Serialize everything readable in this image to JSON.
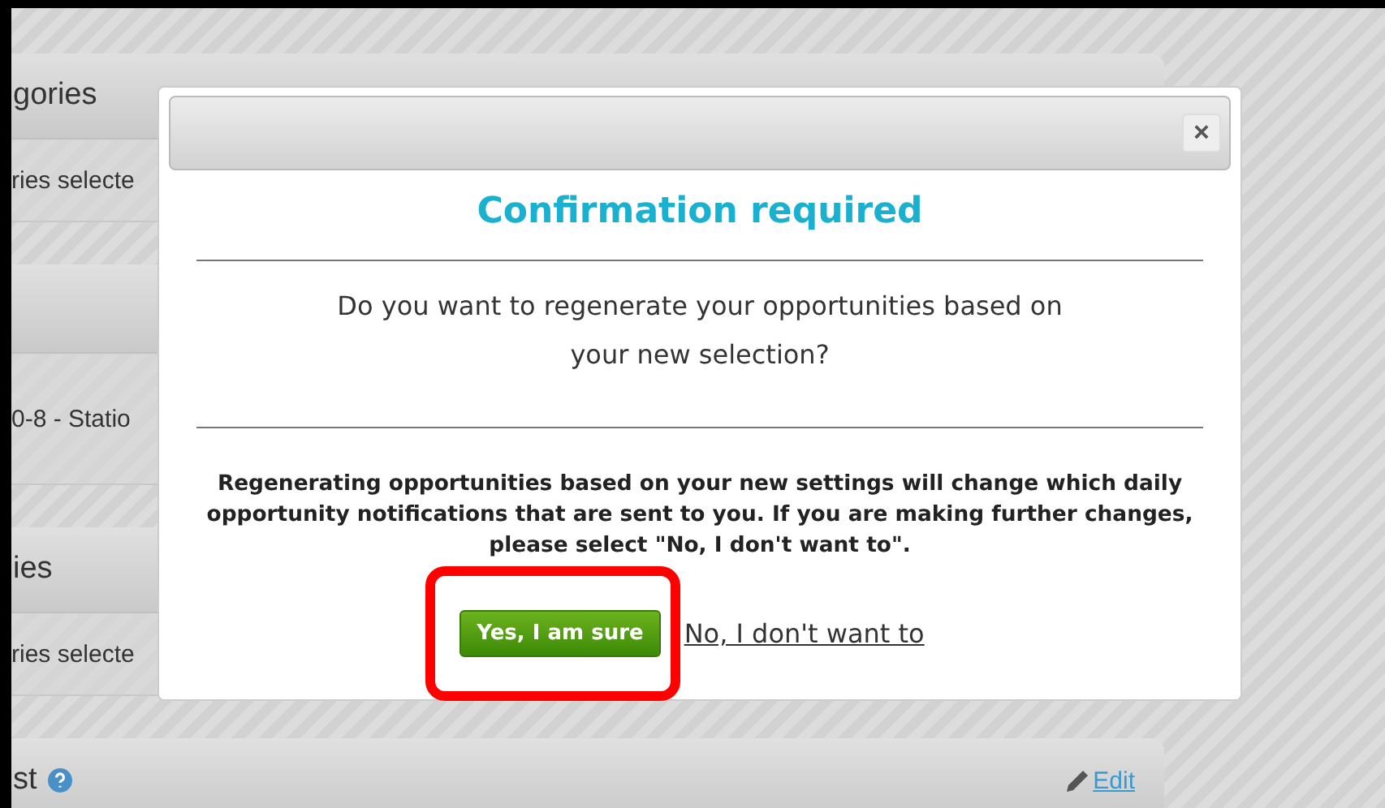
{
  "background_panels": [
    {
      "title": "gories",
      "detail": "ries selecte"
    },
    {
      "detail": "0-8 - Statio"
    },
    {
      "title": "ies",
      "detail": "ries selecte"
    },
    {
      "title": "st",
      "help": true,
      "edit_link": "Edit"
    }
  ],
  "dialog": {
    "title": "Confirmation required",
    "close": "×",
    "question": "Do you want to regenerate your opportunities based on your new selection?",
    "note": "Regenerating opportunities based on your new settings will change which daily opportunity notifications that are sent to you. If you are making further changes, please select \"No, I don't want to\".",
    "confirm_button": "Yes, I am sure",
    "cancel_link": "No, I don't want to",
    "confirm_highlighted": true
  }
}
